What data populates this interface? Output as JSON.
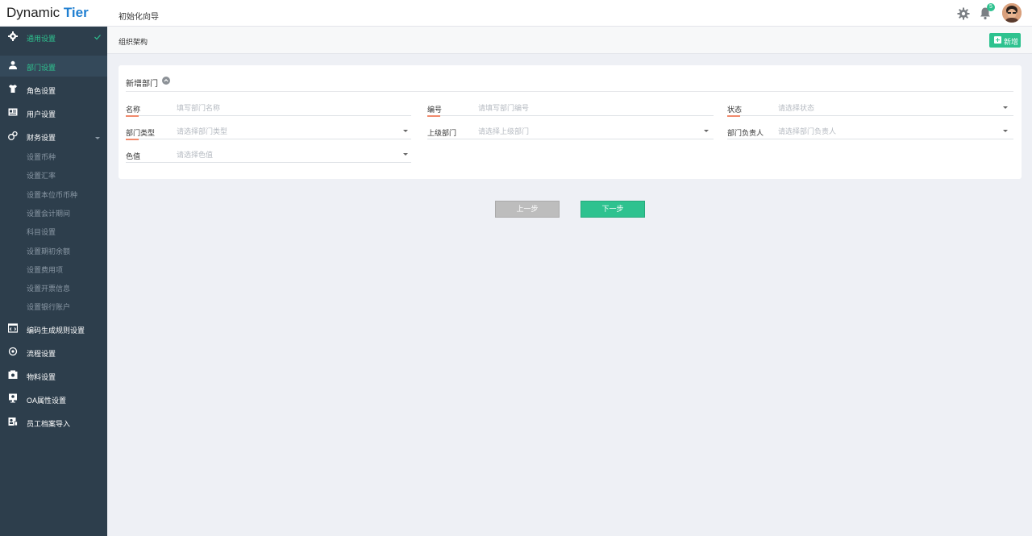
{
  "app": {
    "logo_main": "Dynamic ",
    "logo_accent": "Tier",
    "page_title": "初始化向导",
    "notification_count": "5"
  },
  "sidebar": {
    "section": {
      "label": "通用设置",
      "icon": "gear-icon"
    },
    "items": [
      {
        "label": "部门设置",
        "icon": "org-icon",
        "active": true
      },
      {
        "label": "角色设置",
        "icon": "shirt-icon"
      },
      {
        "label": "用户设置",
        "icon": "id-card-icon"
      },
      {
        "label": "财务设置",
        "icon": "finance-icon",
        "expanded": true
      }
    ],
    "finance_sub": [
      "设置币种",
      "设置汇率",
      "设置本位币币种",
      "设置会计期间",
      "科目设置",
      "设置期初余额",
      "设置费用项",
      "设置开票信息",
      "设置银行账户"
    ],
    "lower_items": [
      {
        "label": "编码生成规则设置",
        "icon": "code-icon"
      },
      {
        "label": "流程设置",
        "icon": "flow-icon"
      },
      {
        "label": "物料设置",
        "icon": "material-icon"
      },
      {
        "label": "OA属性设置",
        "icon": "oa-icon"
      },
      {
        "label": "员工档案导入",
        "icon": "import-icon"
      }
    ]
  },
  "breadcrumb": {
    "current": "组织架构",
    "add_label": "新增"
  },
  "form": {
    "title": "新增部门",
    "fields": [
      {
        "label": "名称",
        "placeholder": "填写部门名称",
        "type": "text"
      },
      {
        "label": "编号",
        "placeholder": "请填写部门编号",
        "type": "text"
      },
      {
        "label": "状态",
        "placeholder": "请选择状态",
        "type": "select"
      },
      {
        "label": "部门类型",
        "placeholder": "请选择部门类型",
        "type": "select"
      },
      {
        "label": "上级部门",
        "placeholder": "请选择上级部门",
        "type": "select"
      },
      {
        "label": "部门负责人",
        "placeholder": "请选择部门负责人",
        "type": "select"
      },
      {
        "label": "色值",
        "placeholder": "请选择色值",
        "type": "select"
      }
    ]
  },
  "steps": {
    "prev": "上一步",
    "next": "下一步"
  },
  "colors": {
    "accent": "#2ec28f",
    "sidebar_bg": "#2d3e4c",
    "brand": "#1f7fd1",
    "label_underline": "#f08a6c"
  }
}
